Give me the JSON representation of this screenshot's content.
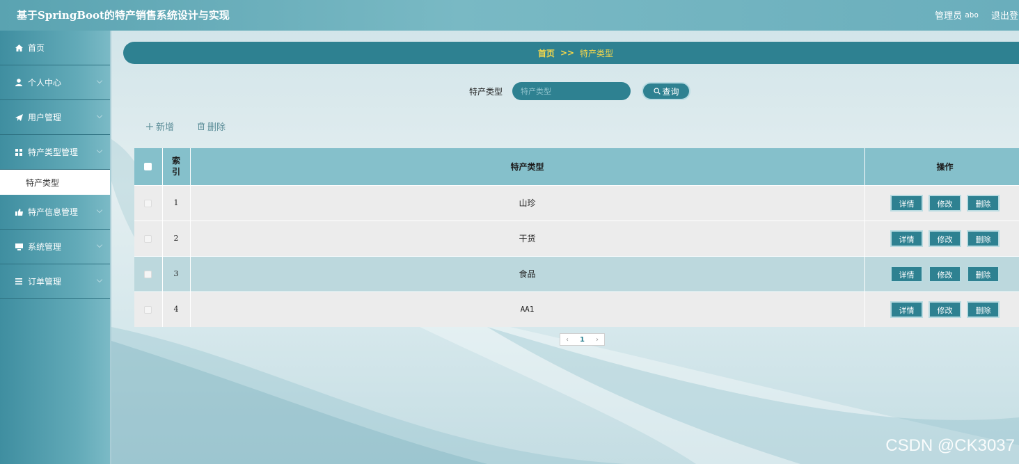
{
  "header": {
    "title": "基于SpringBoot的特产销售系统设计与实现",
    "user_role": "管理员",
    "user_name": "abo",
    "logout": "退出登录"
  },
  "sidebar": {
    "items": [
      {
        "label": "首页",
        "icon": "home-icon"
      },
      {
        "label": "个人中心",
        "icon": "user-icon"
      },
      {
        "label": "用户管理",
        "icon": "send-icon"
      },
      {
        "label": "特产类型管理",
        "icon": "grid-icon"
      },
      {
        "label": "特产信息管理",
        "icon": "thumb-icon"
      },
      {
        "label": "系统管理",
        "icon": "monitor-icon"
      },
      {
        "label": "订单管理",
        "icon": "list-icon"
      }
    ],
    "active_sub": "特产类型"
  },
  "breadcrumb": {
    "home": "首页",
    "separator": ">>",
    "current": "特产类型"
  },
  "search": {
    "label": "特产类型",
    "placeholder": "特产类型",
    "button": "查询"
  },
  "actions": {
    "add": "新增",
    "delete": "删除"
  },
  "table": {
    "headers": [
      "索引",
      "特产类型",
      "操作"
    ],
    "rows": [
      {
        "index": "1",
        "type": "山珍"
      },
      {
        "index": "2",
        "type": "干货"
      },
      {
        "index": "3",
        "type": "食品"
      },
      {
        "index": "4",
        "type": "AA1"
      }
    ],
    "row_actions": [
      "详情",
      "修改",
      "删除"
    ]
  },
  "pagination": {
    "current": "1"
  },
  "watermark": "CSDN @CK3037",
  "colors": {
    "accent": "#2e8191",
    "header": "#6aaebc",
    "breadcrumb_text": "#f6d84a"
  }
}
